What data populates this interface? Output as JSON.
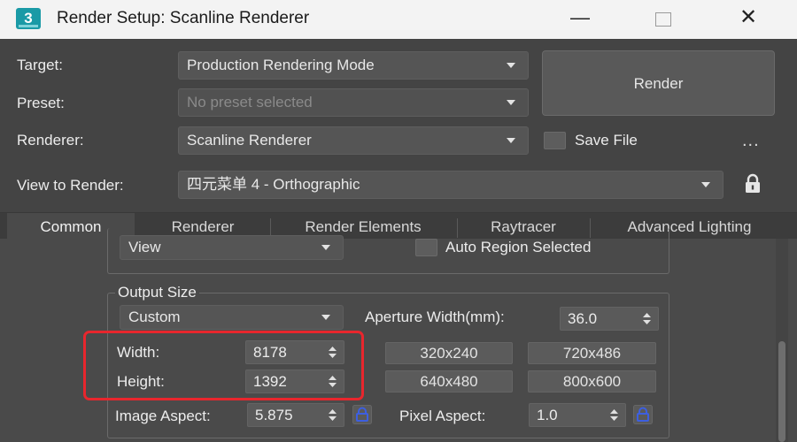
{
  "window": {
    "app_icon_text": "3",
    "title": "Render Setup: Scanline Renderer",
    "controls": {
      "minimize": "—",
      "close": "✕"
    }
  },
  "form": {
    "target": {
      "label": "Target:",
      "value": "Production Rendering Mode"
    },
    "preset": {
      "label": "Preset:",
      "placeholder": "No preset selected"
    },
    "renderer": {
      "label": "Renderer:",
      "value": "Scanline Renderer"
    },
    "view_to_render": {
      "label": "View to Render:",
      "value": "四元菜单 4 - Orthographic"
    },
    "render_button": "Render",
    "save_file": {
      "label": "Save File",
      "checked": false
    },
    "more_options": "...",
    "lock_icon": "lock-icon"
  },
  "tabs": [
    {
      "label": "Common",
      "active": true
    },
    {
      "label": "Renderer",
      "active": false
    },
    {
      "label": "Render Elements",
      "active": false
    },
    {
      "label": "Raytracer",
      "active": false
    },
    {
      "label": "Advanced Lighting",
      "active": false
    }
  ],
  "area": {
    "dropdown_value": "View",
    "auto_region_label": "Auto Region Selected",
    "auto_region_checked": false
  },
  "output_size": {
    "title": "Output Size",
    "preset_dropdown": "Custom",
    "aperture_label": "Aperture Width(mm):",
    "aperture_value": "36.0",
    "width_label": "Width:",
    "width_value": "8178",
    "height_label": "Height:",
    "height_value": "1392",
    "presets": [
      "320x240",
      "720x486",
      "640x480",
      "800x600"
    ],
    "image_aspect_label": "Image Aspect:",
    "image_aspect_value": "5.875",
    "pixel_aspect_label": "Pixel Aspect:",
    "pixel_aspect_value": "1.0"
  },
  "colors": {
    "highlight": "#e8262d",
    "link_icon": "#3d5fe0"
  }
}
